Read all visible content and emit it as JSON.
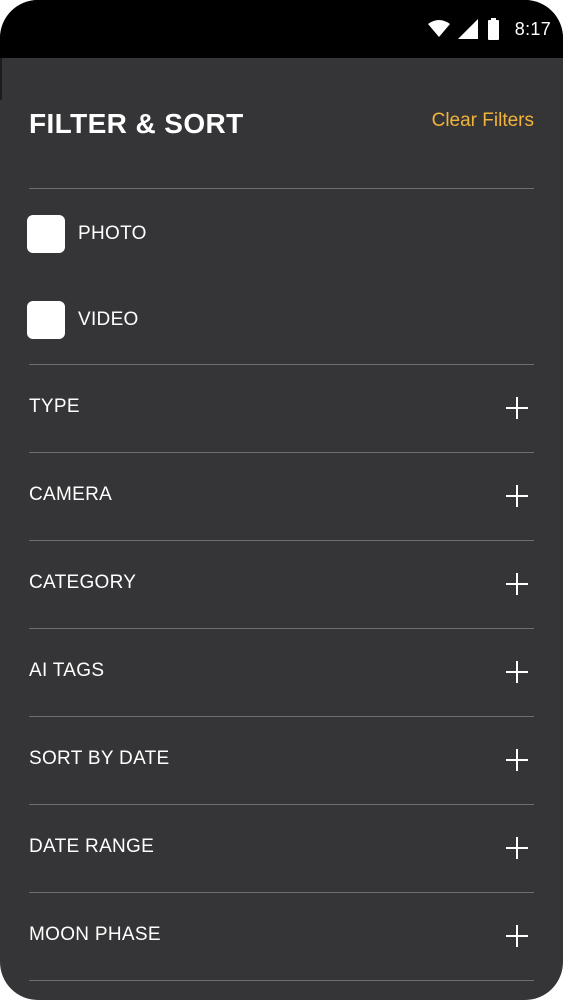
{
  "status_bar": {
    "time": "8:17",
    "icons": [
      "wifi-icon",
      "signal-icon",
      "battery-icon"
    ]
  },
  "header": {
    "title": "FILTER & SORT",
    "clear_label": "Clear Filters"
  },
  "media_filters": [
    {
      "label": "PHOTO",
      "checked": false
    },
    {
      "label": "VIDEO",
      "checked": false
    }
  ],
  "sections": [
    {
      "label": "TYPE",
      "icon": "plus-icon"
    },
    {
      "label": "CAMERA",
      "icon": "plus-icon"
    },
    {
      "label": "CATEGORY",
      "icon": "plus-icon"
    },
    {
      "label": "AI TAGS",
      "icon": "plus-icon"
    },
    {
      "label": "SORT BY DATE",
      "icon": "plus-icon"
    },
    {
      "label": "DATE RANGE",
      "icon": "plus-icon"
    },
    {
      "label": "MOON PHASE",
      "icon": "plus-icon"
    }
  ],
  "colors": {
    "background": "#353436",
    "status_bar": "#000000",
    "accent": "#f0b43a",
    "divider": "#6e6d70",
    "text": "#ffffff"
  }
}
